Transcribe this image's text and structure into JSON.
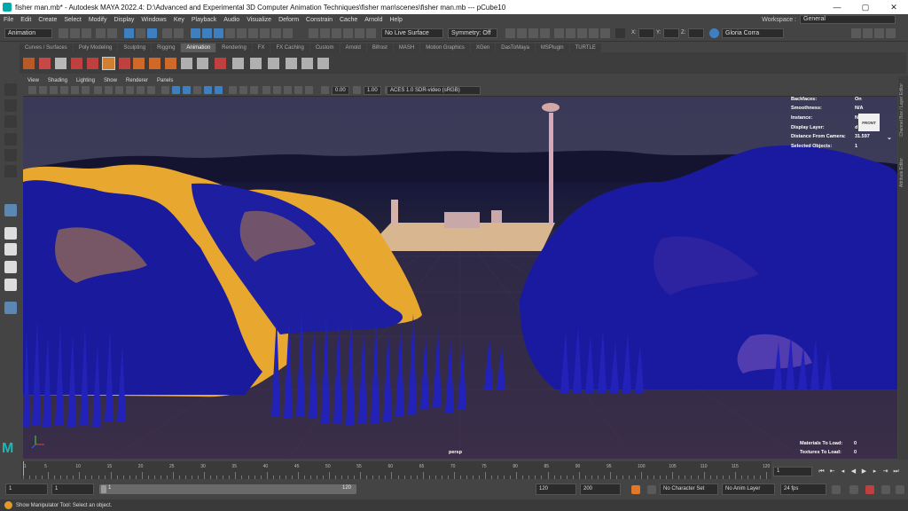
{
  "window": {
    "title": "fisher man.mb* - Autodesk MAYA 2022.4: D:\\Advanced and Experimental 3D Computer Animation Techniques\\fisher man\\scenes\\fisher man.mb   ---   pCube10",
    "minimize": "—",
    "maximize": "▢",
    "close": "✕"
  },
  "menu": [
    "File",
    "Edit",
    "Create",
    "Select",
    "Modify",
    "Display",
    "Windows",
    "Key",
    "Playback",
    "Audio",
    "Visualize",
    "Deform",
    "Constrain",
    "Cache",
    "Arnold",
    "Help"
  ],
  "workspace": {
    "label": "Workspace :",
    "value": "General"
  },
  "statusline": {
    "menuset": "Animation",
    "live_surface": "No Live Surface",
    "symmetry": "Symmetry: Off",
    "x_label": "X:",
    "y_label": "Y:",
    "z_label": "Z:",
    "user": "Gloria Corra"
  },
  "shelf_tabs": [
    "Curves / Surfaces",
    "Poly Modeling",
    "Sculpting",
    "Rigging",
    "Animation",
    "Rendering",
    "FX",
    "FX Caching",
    "Custom",
    "Arnold",
    "Bifrost",
    "MASH",
    "Motion Graphics",
    "XGen",
    "DasToMaya",
    "MSPlugin",
    "TURTLE"
  ],
  "shelf_active": "Animation",
  "viewport": {
    "menus": [
      "View",
      "Shading",
      "Lighting",
      "Show",
      "Renderer",
      "Panels"
    ],
    "exposure": "0.00",
    "gamma": "1.00",
    "color_space": "ACES 1.0 SDR-video (sRGB)",
    "camera": "persp",
    "view_cube": "FRONT",
    "hud": [
      {
        "label": "Backfaces:",
        "value": "On"
      },
      {
        "label": "Smoothness:",
        "value": "N/A"
      },
      {
        "label": "Instance:",
        "value": "N"
      },
      {
        "label": "Display Layer:",
        "value": "d"
      },
      {
        "label": "Distance From Camera:",
        "value": "31.597"
      },
      {
        "label": "Selected Objects:",
        "value": "1"
      }
    ],
    "hud_bottom": [
      {
        "label": "Materials To Load:",
        "value": "0"
      },
      {
        "label": "Textures To Load:",
        "value": "0"
      }
    ]
  },
  "side_tabs": [
    "Channel Box / Layer Editor",
    "Attribute Editor"
  ],
  "timeline": {
    "ticks": [
      "5",
      "10",
      "15",
      "20",
      "25",
      "30",
      "35",
      "40",
      "45",
      "50",
      "55",
      "60",
      "65",
      "70",
      "75",
      "80",
      "85",
      "90",
      "95",
      "100",
      "105",
      "110",
      "115",
      "120"
    ],
    "tick_start": "1",
    "current_frame": "1"
  },
  "range": {
    "start": "1",
    "playback_start": "1",
    "bar_start": "1",
    "bar_end": "120",
    "playback_end": "120",
    "end": "200",
    "character_set": "No Character Set",
    "anim_layer": "No Anim Layer",
    "fps": "24 fps"
  },
  "help_line": "Show Manipulator Tool: Select an object.",
  "colors": {
    "accent": "#3d7fbf",
    "rock_blue": "#1a1a9c",
    "rock_yellow": "#e8a830",
    "sky": "#3a3a58"
  }
}
